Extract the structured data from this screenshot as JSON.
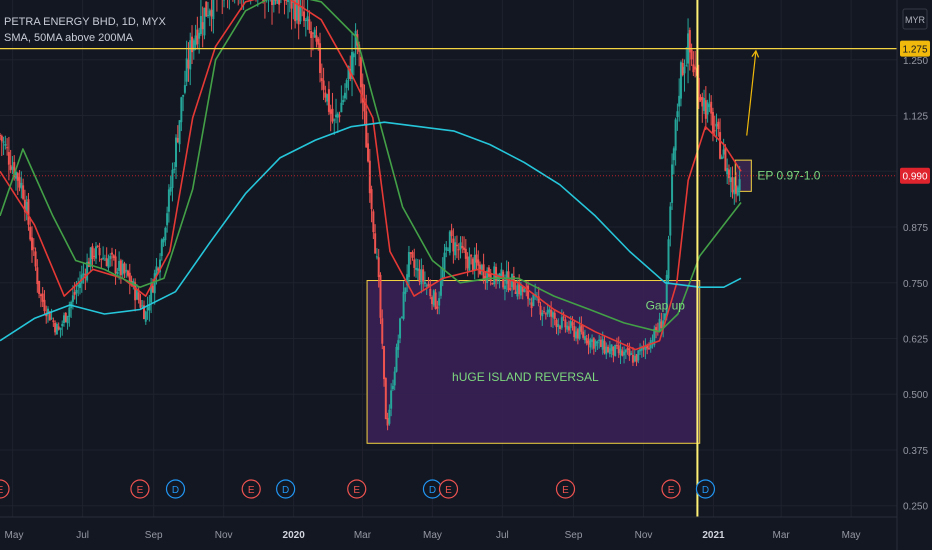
{
  "header": {
    "symbol": "PETRA ENERGY BHD, 1D, MYX",
    "indicator": "SMA, 50MA above 200MA"
  },
  "currency_button": "MYR",
  "colors": {
    "background": "#131722",
    "grid": "#1e222d",
    "up_candle": "#26a69a",
    "down_candle": "#ef5350",
    "ma_red": "#e53935",
    "ma_green": "#43a047",
    "ma_cyan": "#26c6da",
    "highlight_yellow": "#f5d442",
    "box_fill": "#3b2158",
    "price_badge": "#e0242e",
    "level_badge": "#f0b90b"
  },
  "chart_data": {
    "type": "candlestick",
    "title": "PETRA ENERGY BHD, 1D, MYX",
    "currency": "MYR",
    "y_axis": {
      "ticks": [
        1.25,
        1.125,
        1.0,
        0.875,
        0.75,
        0.625,
        0.5,
        0.375,
        0.25
      ],
      "tick_labels": [
        "1.250",
        "1.125",
        "",
        "0.875",
        "0.750",
        "0.625",
        "0.500",
        "0.375",
        "0.250"
      ],
      "range": [
        0.2,
        1.42
      ]
    },
    "x_axis": {
      "tick_labels": [
        "May",
        "Jul",
        "Sep",
        "Nov",
        "2020",
        "Mar",
        "May",
        "Jul",
        "Sep",
        "Nov",
        "2021",
        "Mar",
        "May"
      ],
      "tick_dates": [
        "2019-05-01",
        "2019-07-01",
        "2019-09-01",
        "2019-11-01",
        "2020-01-01",
        "2020-03-01",
        "2020-05-01",
        "2020-07-01",
        "2020-09-01",
        "2020-11-01",
        "2021-01-01",
        "2021-03-01",
        "2021-05-01"
      ]
    },
    "current_price": {
      "value": 0.99,
      "label": "0.990"
    },
    "horizontal_level": {
      "value": 1.275,
      "label": "1.275"
    },
    "vertical_marker_date": "2020-12-18",
    "close_path": [
      [
        "2019-04-20",
        1.08
      ],
      [
        "2019-05-10",
        0.96
      ],
      [
        "2019-05-25",
        0.72
      ],
      [
        "2019-06-10",
        0.64
      ],
      [
        "2019-06-25",
        0.73
      ],
      [
        "2019-07-10",
        0.82
      ],
      [
        "2019-07-25",
        0.8
      ],
      [
        "2019-08-10",
        0.76
      ],
      [
        "2019-08-25",
        0.68
      ],
      [
        "2019-09-05",
        0.8
      ],
      [
        "2019-09-15",
        0.95
      ],
      [
        "2019-09-25",
        1.15
      ],
      [
        "2019-10-05",
        1.3
      ],
      [
        "2019-10-20",
        1.38
      ],
      [
        "2019-11-05",
        1.42
      ],
      [
        "2019-11-25",
        1.43
      ],
      [
        "2019-12-15",
        1.4
      ],
      [
        "2020-01-01",
        1.38
      ],
      [
        "2020-01-20",
        1.28
      ],
      [
        "2020-02-05",
        1.1
      ],
      [
        "2020-02-15",
        1.18
      ],
      [
        "2020-02-25",
        1.3
      ],
      [
        "2020-03-05",
        1.05
      ],
      [
        "2020-03-15",
        0.75
      ],
      [
        "2020-03-22",
        0.42
      ],
      [
        "2020-04-01",
        0.62
      ],
      [
        "2020-04-10",
        0.8
      ],
      [
        "2020-04-25",
        0.75
      ],
      [
        "2020-05-05",
        0.7
      ],
      [
        "2020-05-15",
        0.85
      ],
      [
        "2020-06-01",
        0.8
      ],
      [
        "2020-06-20",
        0.77
      ],
      [
        "2020-07-10",
        0.75
      ],
      [
        "2020-08-01",
        0.7
      ],
      [
        "2020-08-20",
        0.66
      ],
      [
        "2020-09-10",
        0.63
      ],
      [
        "2020-10-01",
        0.6
      ],
      [
        "2020-10-25",
        0.58
      ],
      [
        "2020-11-10",
        0.63
      ],
      [
        "2020-11-20",
        0.68
      ],
      [
        "2020-11-26",
        1.0
      ],
      [
        "2020-12-03",
        1.22
      ],
      [
        "2020-12-10",
        1.28
      ],
      [
        "2020-12-20",
        1.18
      ],
      [
        "2021-01-01",
        1.1
      ],
      [
        "2021-01-10",
        1.03
      ],
      [
        "2021-01-18",
        0.96
      ],
      [
        "2021-01-25",
        0.99
      ]
    ],
    "series": [
      {
        "name": "SMA",
        "color": "#e53935",
        "points": [
          [
            "2019-04-20",
            1.0
          ],
          [
            "2019-05-20",
            0.88
          ],
          [
            "2019-06-15",
            0.72
          ],
          [
            "2019-07-10",
            0.78
          ],
          [
            "2019-08-05",
            0.76
          ],
          [
            "2019-08-25",
            0.72
          ],
          [
            "2019-09-15",
            0.82
          ],
          [
            "2019-10-05",
            1.12
          ],
          [
            "2019-10-25",
            1.28
          ],
          [
            "2019-11-20",
            1.38
          ],
          [
            "2019-12-20",
            1.4
          ],
          [
            "2020-01-25",
            1.34
          ],
          [
            "2020-02-20",
            1.22
          ],
          [
            "2020-03-10",
            1.12
          ],
          [
            "2020-03-25",
            0.82
          ],
          [
            "2020-04-15",
            0.72
          ],
          [
            "2020-05-10",
            0.76
          ],
          [
            "2020-06-10",
            0.78
          ],
          [
            "2020-07-15",
            0.75
          ],
          [
            "2020-08-15",
            0.69
          ],
          [
            "2020-09-20",
            0.64
          ],
          [
            "2020-10-25",
            0.6
          ],
          [
            "2020-11-15",
            0.62
          ],
          [
            "2020-11-30",
            0.75
          ],
          [
            "2020-12-10",
            0.98
          ],
          [
            "2020-12-25",
            1.1
          ],
          [
            "2021-01-10",
            1.06
          ],
          [
            "2021-01-25",
            1.0
          ]
        ]
      },
      {
        "name": "50MA",
        "color": "#43a047",
        "points": [
          [
            "2019-04-20",
            0.9
          ],
          [
            "2019-05-10",
            1.05
          ],
          [
            "2019-06-05",
            0.9
          ],
          [
            "2019-06-25",
            0.8
          ],
          [
            "2019-07-20",
            0.78
          ],
          [
            "2019-08-20",
            0.74
          ],
          [
            "2019-09-10",
            0.76
          ],
          [
            "2019-10-05",
            0.96
          ],
          [
            "2019-10-25",
            1.25
          ],
          [
            "2019-11-20",
            1.36
          ],
          [
            "2019-12-20",
            1.4
          ],
          [
            "2020-01-25",
            1.38
          ],
          [
            "2020-02-25",
            1.3
          ],
          [
            "2020-03-15",
            1.12
          ],
          [
            "2020-04-05",
            0.92
          ],
          [
            "2020-05-01",
            0.8
          ],
          [
            "2020-05-25",
            0.75
          ],
          [
            "2020-06-20",
            0.76
          ],
          [
            "2020-07-15",
            0.76
          ],
          [
            "2020-08-15",
            0.72
          ],
          [
            "2020-09-15",
            0.69
          ],
          [
            "2020-10-15",
            0.66
          ],
          [
            "2020-11-15",
            0.64
          ],
          [
            "2020-12-01",
            0.68
          ],
          [
            "2020-12-20",
            0.81
          ],
          [
            "2021-01-10",
            0.88
          ],
          [
            "2021-01-25",
            0.93
          ]
        ]
      },
      {
        "name": "200MA",
        "color": "#26c6da",
        "points": [
          [
            "2019-04-20",
            0.62
          ],
          [
            "2019-05-20",
            0.67
          ],
          [
            "2019-06-20",
            0.7
          ],
          [
            "2019-07-20",
            0.68
          ],
          [
            "2019-08-20",
            0.69
          ],
          [
            "2019-09-20",
            0.73
          ],
          [
            "2019-10-20",
            0.84
          ],
          [
            "2019-11-20",
            0.95
          ],
          [
            "2019-12-20",
            1.03
          ],
          [
            "2020-01-20",
            1.07
          ],
          [
            "2020-02-20",
            1.1
          ],
          [
            "2020-03-20",
            1.11
          ],
          [
            "2020-04-20",
            1.1
          ],
          [
            "2020-05-20",
            1.09
          ],
          [
            "2020-06-20",
            1.06
          ],
          [
            "2020-07-20",
            1.02
          ],
          [
            "2020-08-20",
            0.97
          ],
          [
            "2020-09-20",
            0.9
          ],
          [
            "2020-10-20",
            0.82
          ],
          [
            "2020-11-20",
            0.75
          ],
          [
            "2020-12-20",
            0.74
          ],
          [
            "2021-01-10",
            0.74
          ],
          [
            "2021-01-25",
            0.76
          ]
        ]
      }
    ],
    "annotations": [
      {
        "text": "hUGE ISLAND REVERSAL",
        "type": "rectangle",
        "date_start": "2020-03-05",
        "date_end": "2020-12-20",
        "price_low": 0.39,
        "price_high": 0.755
      },
      {
        "text": "Gap up",
        "type": "label",
        "date": "2020-11-20",
        "price": 0.69
      },
      {
        "text": "EP 0.97-1.0",
        "type": "rectangle",
        "date_start": "2021-01-20",
        "date_end": "2021-02-03",
        "price_low": 0.955,
        "price_high": 1.025
      },
      {
        "text": "",
        "type": "arrow",
        "date_start": "2021-01-30",
        "price_start": 1.08,
        "date_end": "2021-02-07",
        "price_end": 1.27
      }
    ],
    "events": [
      {
        "label": "E",
        "date": "2019-04-20"
      },
      {
        "label": "E",
        "date": "2019-08-20"
      },
      {
        "label": "D",
        "date": "2019-09-20"
      },
      {
        "label": "E",
        "date": "2019-11-25"
      },
      {
        "label": "D",
        "date": "2019-12-25"
      },
      {
        "label": "E",
        "date": "2020-02-25"
      },
      {
        "label": "D",
        "date": "2020-05-01"
      },
      {
        "label": "E",
        "date": "2020-05-15"
      },
      {
        "label": "E",
        "date": "2020-08-25"
      },
      {
        "label": "E",
        "date": "2020-11-25"
      },
      {
        "label": "D",
        "date": "2020-12-25"
      }
    ]
  }
}
